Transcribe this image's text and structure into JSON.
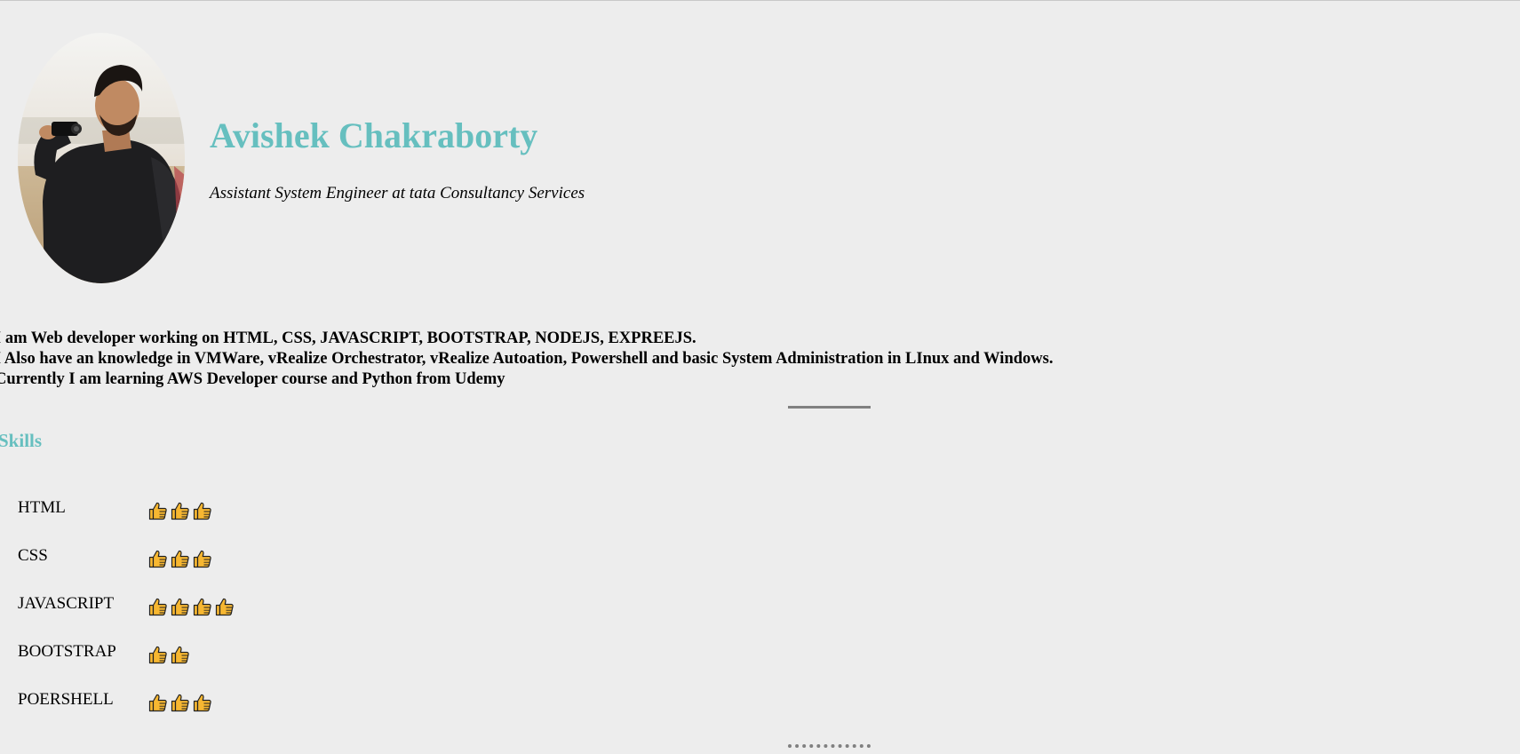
{
  "profile": {
    "name": "Avishek Chakraborty",
    "subtitle": "Assistant System Engineer at tata Consultancy Services",
    "avatar_alt": "profile-photo"
  },
  "bio": {
    "lines": [
      "I am Web developer working on HTML, CSS, JAVASCRIPT, BOOTSTRAP, NODEJS, EXPREEJS.",
      "I Also have an knowledge in VMWare, vRealize Orchestrator, vRealize Autoation, Powershell and basic System Administration in LInux and Windows.",
      "Currently I am learning AWS Developer course and Python from Udemy"
    ]
  },
  "skills": {
    "title": "Skills",
    "items": [
      {
        "name": "HTML",
        "rating": 3
      },
      {
        "name": "CSS",
        "rating": 3
      },
      {
        "name": "JAVASCRIPT",
        "rating": 4
      },
      {
        "name": "BOOTSTRAP",
        "rating": 2
      },
      {
        "name": "POERSHELL",
        "rating": 3
      }
    ]
  },
  "colors": {
    "accent": "#66bfbf",
    "background": "#ededed",
    "divider": "#808080",
    "thumb": "#f7b731"
  },
  "icons": {
    "rating": "thumbs-up-icon"
  }
}
